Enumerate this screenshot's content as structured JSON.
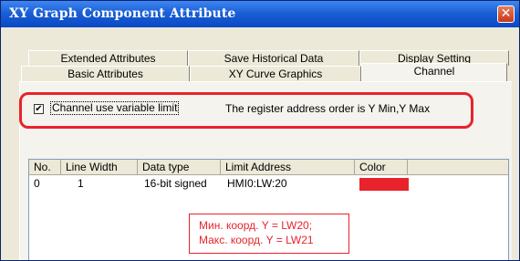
{
  "window": {
    "title": "XY Graph Component Attribute"
  },
  "tabs": {
    "row1": [
      "Extended Attributes",
      "Save Historical Data",
      "Display Setting"
    ],
    "row2": [
      "Basic Attributes",
      "XY Curve Graphics",
      "Channel"
    ],
    "active": "Channel"
  },
  "channel": {
    "use_variable_limit_label": "Channel use variable limit",
    "use_variable_limit_checked": true,
    "order_note": "The register address order is Y Min,Y Max"
  },
  "list": {
    "headers": [
      "No.",
      "Line Width",
      "Data type",
      "Limit Address",
      "Color"
    ],
    "rows": [
      {
        "no": "0",
        "line_width": "1",
        "data_type": "16-bit signed",
        "limit_address": "HMI0:LW:20",
        "color": "#e8232c"
      }
    ]
  },
  "annotation": {
    "line1": "Мин. коорд. Y = LW20;",
    "line2": "Макс. коорд. Y = LW21"
  },
  "colors": {
    "title_bar": "#0a48c4",
    "highlight": "#e8232c",
    "dialog_bg": "#ece9d8"
  }
}
